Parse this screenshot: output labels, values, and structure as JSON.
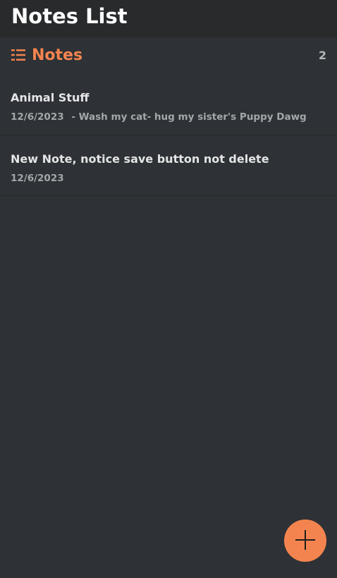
{
  "header": {
    "title": "Notes List"
  },
  "section": {
    "icon": "list-icon",
    "title": "Notes",
    "count": "2"
  },
  "notes": [
    {
      "title": "Animal Stuff",
      "date": "12/6/2023",
      "preview": "- Wash my cat- hug my sister's Puppy Dawg"
    },
    {
      "title": "New Note, notice save button not delete",
      "date": "12/6/2023",
      "preview": ""
    }
  ],
  "fab": {
    "icon": "plus-icon"
  },
  "colors": {
    "accent": "#f4844f",
    "background": "#2e3135",
    "header_background": "#282a2c"
  }
}
